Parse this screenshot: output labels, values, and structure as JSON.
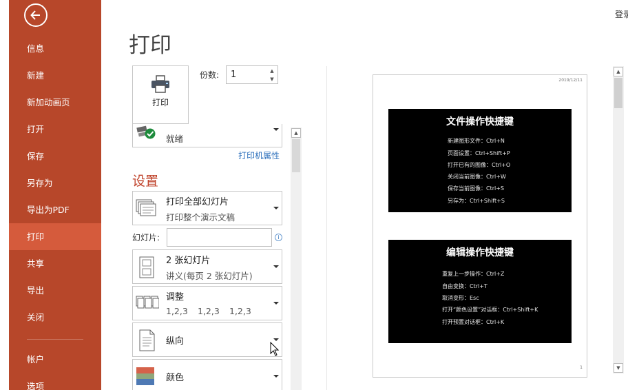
{
  "sidebar": {
    "items": [
      {
        "label": "信息"
      },
      {
        "label": "新建"
      },
      {
        "label": "新加动画页"
      },
      {
        "label": "打开"
      },
      {
        "label": "保存"
      },
      {
        "label": "另存为"
      },
      {
        "label": "导出为PDF"
      },
      {
        "label": "打印"
      },
      {
        "label": "共享"
      },
      {
        "label": "导出"
      },
      {
        "label": "关闭"
      },
      {
        "label": "帐户"
      },
      {
        "label": "选项"
      }
    ],
    "active_label": "打印",
    "colors": {
      "background": "#b7472a",
      "active": "#d55b3c"
    }
  },
  "header": {
    "login_label": "登录"
  },
  "page_title": "打印",
  "print_button": {
    "label": "打印",
    "icon": "printer-icon"
  },
  "copies": {
    "label": "份数:",
    "value": "1"
  },
  "printer": {
    "status": "就绪",
    "properties_link": "打印机属性"
  },
  "settings": {
    "title": "设置",
    "print_range": {
      "title": "打印全部幻灯片",
      "subtitle": "打印整个演示文稿"
    },
    "slides_label": "幻灯片:",
    "slides_value": "",
    "layout": {
      "title": "2 张幻灯片",
      "subtitle": "讲义(每页 2 张幻灯片)"
    },
    "collate": {
      "title": "调整",
      "sets": [
        "1,2,3",
        "1,2,3",
        "1,2,3"
      ]
    },
    "orientation": {
      "title": "纵向"
    },
    "color": {
      "title": "颜色"
    }
  },
  "preview": {
    "date": "2019/12/11",
    "page_number": "1",
    "slides": [
      {
        "title": "文件操作快捷键",
        "lines": [
          "新建图形文件：Ctrl+N",
          "页面设置：Ctrl+Shift+P",
          "打开已有的图像：Ctrl+O",
          "关闭当前图像：Ctrl+W",
          "保存当前图像：Ctrl+S",
          "另存为：Ctrl+Shift+S"
        ]
      },
      {
        "title": "编辑操作快捷键",
        "lines": [
          "重复上一步操作：Ctrl+Z",
          "自由变换：Ctrl+T",
          "取消变形：Esc",
          "打开“颜色设置”对话框：Ctrl+Shift+K",
          "打开预置对话框：Ctrl+K"
        ]
      }
    ]
  }
}
